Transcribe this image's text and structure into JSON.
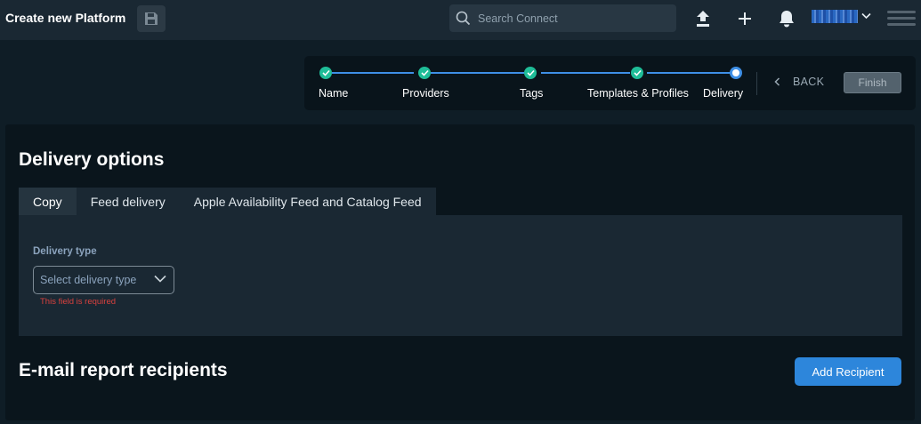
{
  "header": {
    "title": "Create new Platform",
    "search_placeholder": "Search Connect",
    "icons": [
      "save-icon",
      "upload-icon",
      "plus-icon",
      "bell-icon",
      "chevron-down-icon",
      "menu-icon"
    ]
  },
  "stepper": {
    "steps": [
      {
        "label": "Name",
        "state": "done"
      },
      {
        "label": "Providers",
        "state": "done"
      },
      {
        "label": "Tags",
        "state": "done"
      },
      {
        "label": "Templates & Profiles",
        "state": "done"
      },
      {
        "label": "Delivery",
        "state": "current"
      }
    ],
    "back_label": "BACK",
    "finish_label": "Finish"
  },
  "delivery": {
    "title": "Delivery options",
    "tabs": [
      {
        "label": "Copy",
        "active": true
      },
      {
        "label": "Feed delivery",
        "active": false
      },
      {
        "label": "Apple Availability Feed and Catalog Feed",
        "active": false
      }
    ],
    "field_label": "Delivery type",
    "select_placeholder": "Select delivery type",
    "error": "This field is required"
  },
  "email": {
    "title": "E-mail report recipients",
    "add_label": "Add Recipient"
  },
  "colors": {
    "accent": "#3e8fe6",
    "done": "#1fbd98",
    "error": "#d9413e"
  }
}
